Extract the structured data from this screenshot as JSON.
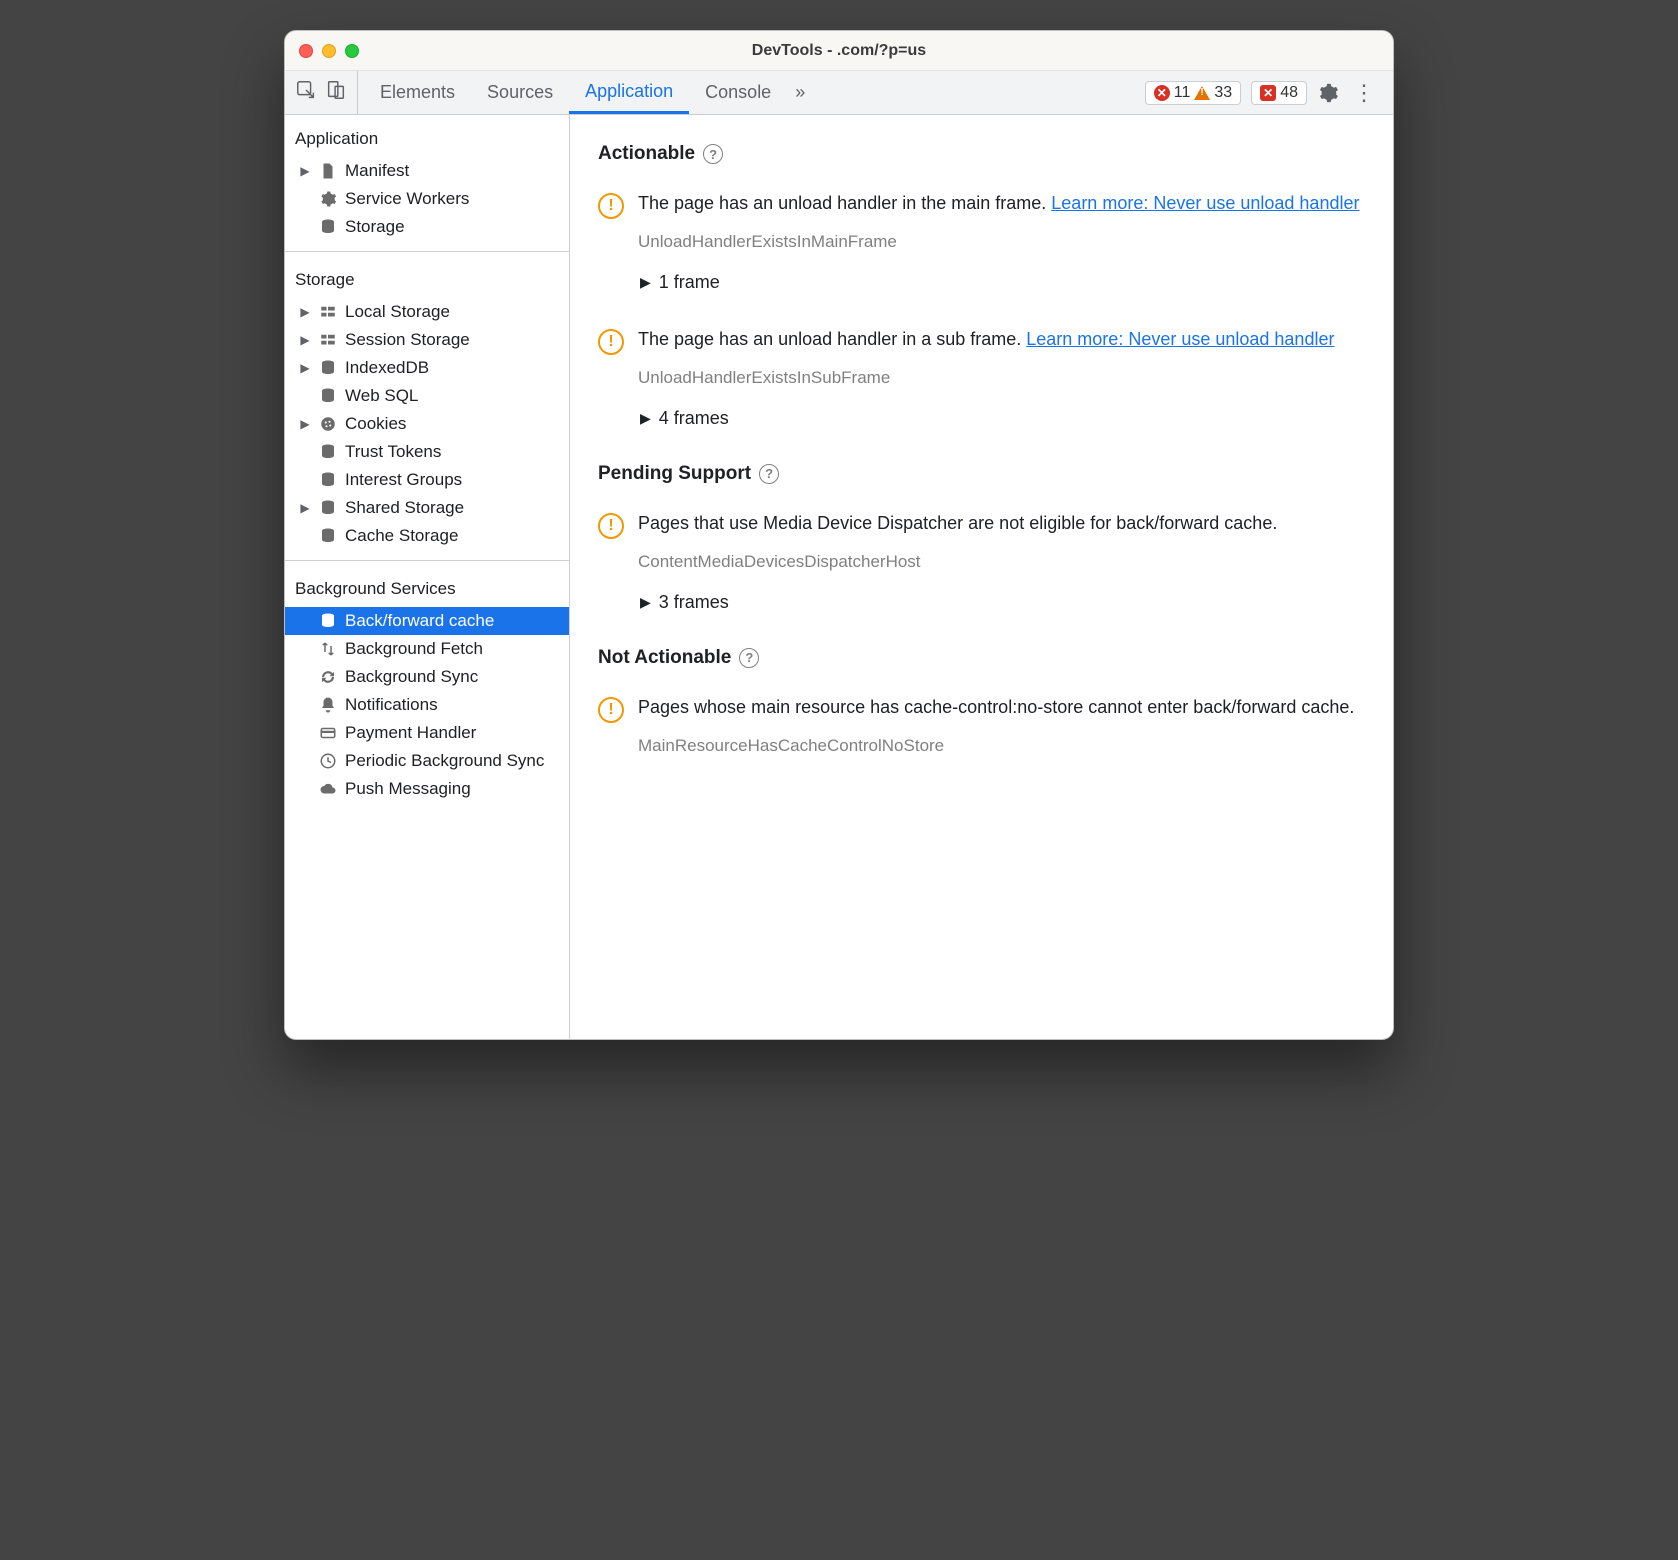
{
  "window": {
    "title": "DevTools -             .com/?p=us"
  },
  "toolbar": {
    "tabs": [
      "Elements",
      "Sources",
      "Application",
      "Console"
    ],
    "active_tab": "Application",
    "errors": "11",
    "warnings": "33",
    "issues": "48"
  },
  "sidebar": {
    "sections": {
      "application": {
        "title": "Application",
        "items": [
          {
            "label": "Manifest",
            "icon": "file",
            "expandable": true
          },
          {
            "label": "Service Workers",
            "icon": "gear"
          },
          {
            "label": "Storage",
            "icon": "db"
          }
        ]
      },
      "storage": {
        "title": "Storage",
        "items": [
          {
            "label": "Local Storage",
            "icon": "grid",
            "expandable": true
          },
          {
            "label": "Session Storage",
            "icon": "grid",
            "expandable": true
          },
          {
            "label": "IndexedDB",
            "icon": "db",
            "expandable": true
          },
          {
            "label": "Web SQL",
            "icon": "db"
          },
          {
            "label": "Cookies",
            "icon": "cookie",
            "expandable": true
          },
          {
            "label": "Trust Tokens",
            "icon": "db"
          },
          {
            "label": "Interest Groups",
            "icon": "db"
          },
          {
            "label": "Shared Storage",
            "icon": "db",
            "expandable": true
          },
          {
            "label": "Cache Storage",
            "icon": "db"
          }
        ]
      },
      "background": {
        "title": "Background Services",
        "items": [
          {
            "label": "Back/forward cache",
            "icon": "db",
            "selected": true
          },
          {
            "label": "Background Fetch",
            "icon": "updown"
          },
          {
            "label": "Background Sync",
            "icon": "sync"
          },
          {
            "label": "Notifications",
            "icon": "bell"
          },
          {
            "label": "Payment Handler",
            "icon": "card"
          },
          {
            "label": "Periodic Background Sync",
            "icon": "clock"
          },
          {
            "label": "Push Messaging",
            "icon": "cloud"
          }
        ]
      }
    }
  },
  "main": {
    "groups": [
      {
        "heading": "Actionable",
        "issues": [
          {
            "text": "The page has an unload handler in the main frame. ",
            "link": "Learn more: Never use unload handler",
            "code": "UnloadHandlerExistsInMainFrame",
            "frames": "1 frame"
          },
          {
            "text": "The page has an unload handler in a sub frame. ",
            "link": "Learn more: Never use unload handler",
            "code": "UnloadHandlerExistsInSubFrame",
            "frames": "4 frames"
          }
        ]
      },
      {
        "heading": "Pending Support",
        "issues": [
          {
            "text": "Pages that use Media Device Dispatcher are not eligible for back/forward cache.",
            "link": "",
            "code": "ContentMediaDevicesDispatcherHost",
            "frames": "3 frames"
          }
        ]
      },
      {
        "heading": "Not Actionable",
        "issues": [
          {
            "text": "Pages whose main resource has cache-control:no-store cannot enter back/forward cache.",
            "link": "",
            "code": "MainResourceHasCacheControlNoStore",
            "frames": ""
          }
        ]
      }
    ]
  }
}
